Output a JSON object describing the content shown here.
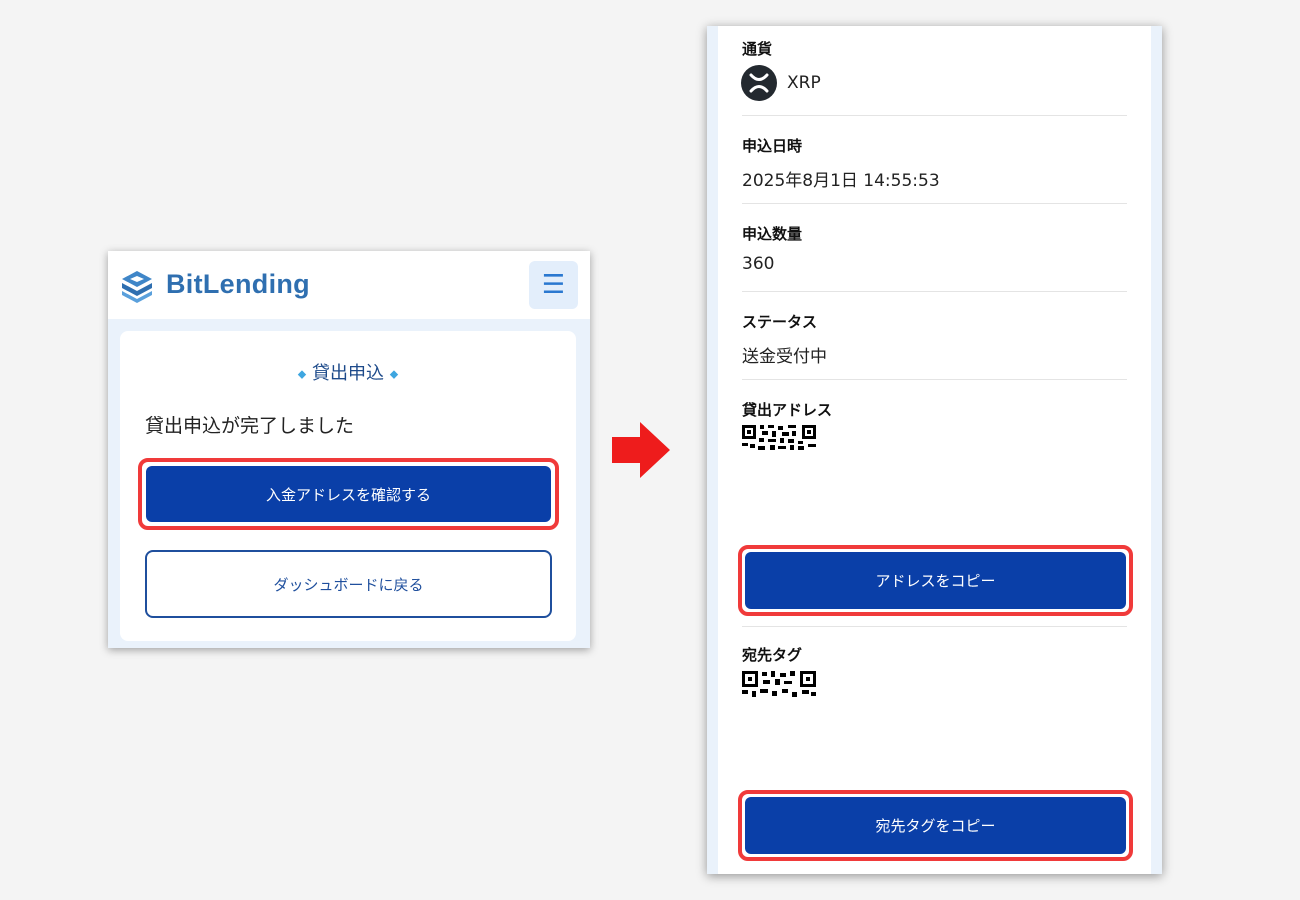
{
  "left_screen": {
    "brand": "BitLending",
    "menu_icon": "hamburger-icon",
    "card_title": "貸出申込",
    "complete_message": "貸出申込が完了しました",
    "confirm_button_label": "入金アドレスを確認する",
    "dashboard_button_label": "ダッシュボードに戻る"
  },
  "arrow_icon": "right-arrow-icon",
  "right_screen": {
    "currency_label": "通貨",
    "currency_value": "XRP",
    "currency_icon": "xrp-icon",
    "date_label": "申込日時",
    "date_value": "2025年8月1日 14:55:53",
    "amount_label": "申込数量",
    "amount_value": "360",
    "status_label": "ステータス",
    "status_value": "送金受付中",
    "address_label": "貸出アドレス",
    "copy_address_label": "アドレスをコピー",
    "tag_label": "宛先タグ",
    "copy_tag_label": "宛先タグをコピー"
  },
  "colors": {
    "primary_button": "#0a3fa8",
    "highlight": "#f03a3a",
    "arrow": "#ee1c1c",
    "page_background": "#f4f4f4",
    "content_background": "#eaf2fb"
  }
}
